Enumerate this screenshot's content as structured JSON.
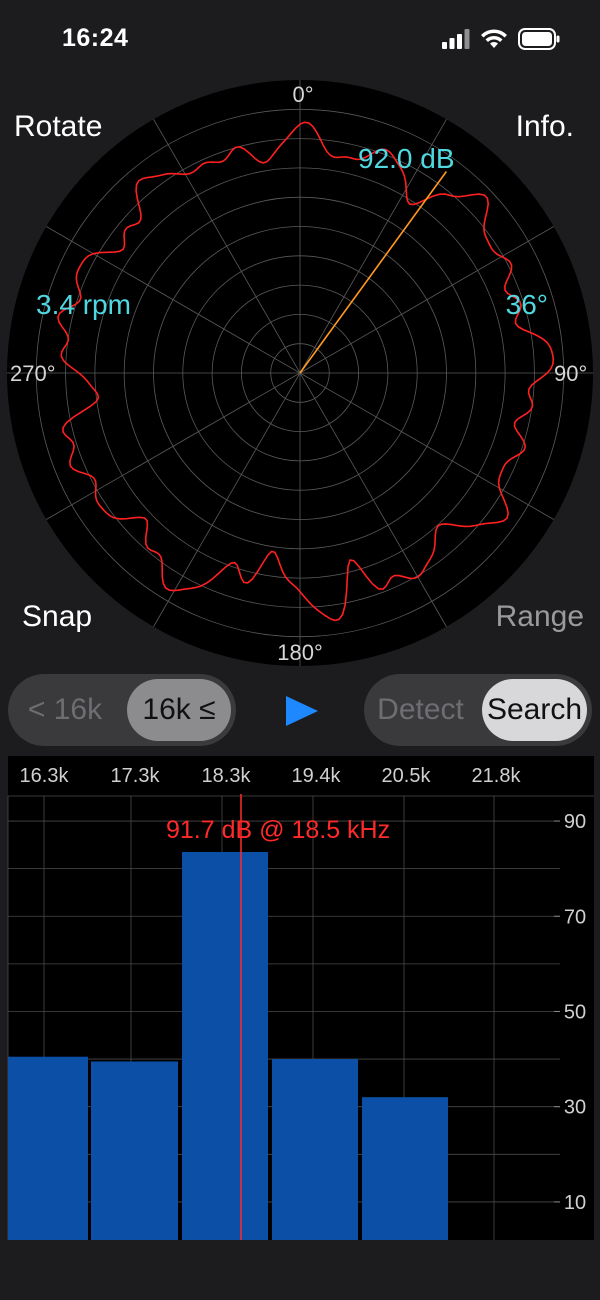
{
  "status": {
    "time": "16:24"
  },
  "polar": {
    "rotate_label": "Rotate",
    "info_label": "Info.",
    "snap_label": "Snap",
    "range_label": "Range",
    "angle_labels": {
      "top": "0°",
      "right": "90°",
      "bottom": "180°",
      "left": "270°"
    },
    "rpm": "3.4 rpm",
    "level": "92.0 dB",
    "angle": "36°",
    "pointer_angle_deg": 36,
    "pointer_level_fraction": 0.85,
    "trace_color": "#ff2020",
    "pointer_color": "#ff9a1f",
    "readout_color": "#4fd8e0"
  },
  "band_toggle": {
    "low_label": "< 16k",
    "high_label": "16k ≤",
    "selected": "high"
  },
  "mode_toggle": {
    "detect_label": "Detect",
    "search_label": "Search",
    "selected": "search"
  },
  "accent_color": "#1e88ff",
  "chart_data": {
    "type": "bar",
    "x_ticks": [
      "16.3k",
      "17.3k",
      "18.3k",
      "19.4k",
      "20.5k",
      "21.8k"
    ],
    "y_ticks": [
      "90",
      "70",
      "50",
      "30",
      "10"
    ],
    "ylim": [
      2,
      94
    ],
    "bars": [
      {
        "x0": 16.0,
        "x1": 16.9,
        "value": 40.5
      },
      {
        "x0": 16.9,
        "x1": 17.9,
        "value": 39.5
      },
      {
        "x0": 17.9,
        "x1": 18.9,
        "value": 83.5
      },
      {
        "x0": 18.9,
        "x1": 19.9,
        "value": 40
      },
      {
        "x0": 19.9,
        "x1": 20.9,
        "value": 32
      }
    ],
    "marker_freq": 18.5,
    "annotation": "91.7 dB @ 18.5 kHz",
    "bar_color": "#0b4fa6",
    "marker_color": "#ff2a2a"
  }
}
